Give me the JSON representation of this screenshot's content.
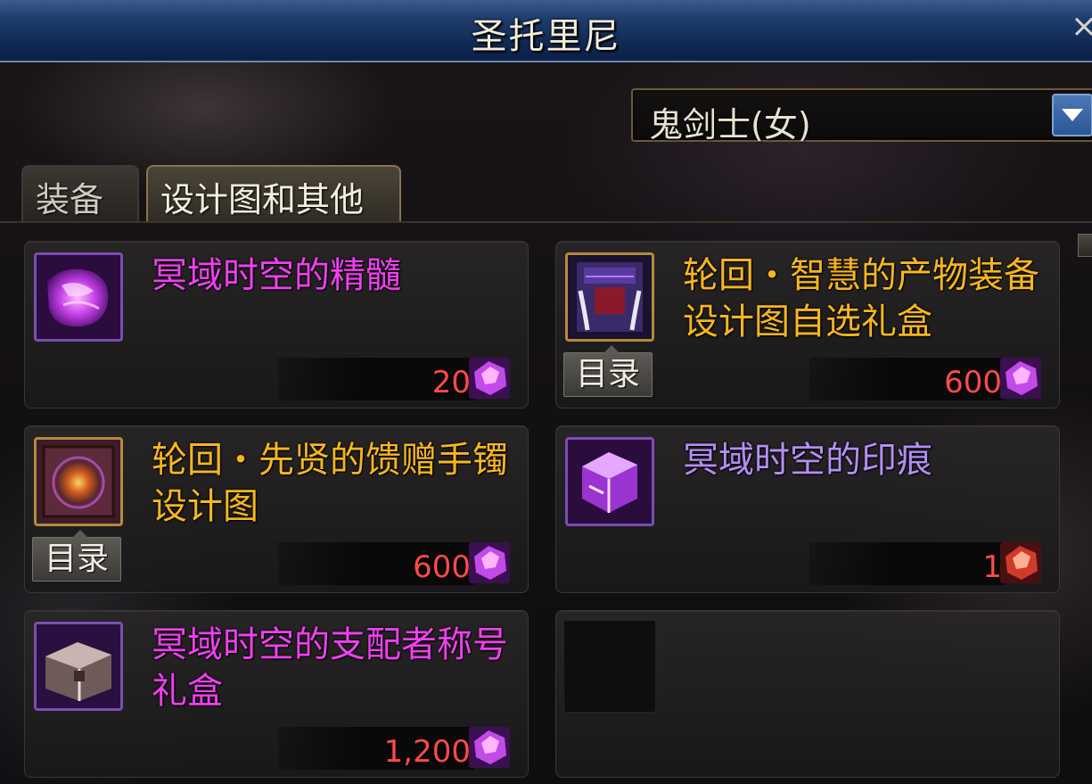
{
  "window": {
    "title": "圣托里尼",
    "close_label": "×"
  },
  "class_filter": {
    "selected": "鬼剑士(女)"
  },
  "tabs": [
    {
      "label": "装备",
      "active": false
    },
    {
      "label": "设计图和其他",
      "active": true
    }
  ],
  "background_text": "",
  "items": [
    {
      "name": "冥域时空的精髓",
      "name_color": "#f03ff0",
      "price": "20",
      "currency": "purple-crystal",
      "catalog": null,
      "icon": "purple-essence-icon"
    },
    {
      "name": "轮回・智慧的产物装备设计图自选礼盒",
      "name_color": "#f7b61e",
      "price": "600",
      "currency": "purple-crystal",
      "catalog": "目录",
      "icon": "design-box-icon"
    },
    {
      "name": "轮回・先贤的馈赠手镯　设计图",
      "name_color": "#f7b61e",
      "price": "600",
      "currency": "purple-crystal",
      "catalog": "目录",
      "icon": "bracelet-scroll-icon"
    },
    {
      "name": "冥域时空的印痕",
      "name_color": "#b48df5",
      "price": "1",
      "currency": "red-crystal",
      "catalog": null,
      "icon": "purple-cube-icon"
    },
    {
      "name": "冥域时空的支配者称号礼盒",
      "name_color": "#f03ff0",
      "price": "1,200",
      "currency": "purple-crystal",
      "catalog": null,
      "icon": "treasure-chest-icon"
    }
  ],
  "colors": {
    "titlebar": "#102a55",
    "price": "#ff4a4a",
    "epic_gold": "#f7b61e",
    "legendary_magenta": "#f03ff0",
    "rare_lavender": "#b48df5"
  }
}
